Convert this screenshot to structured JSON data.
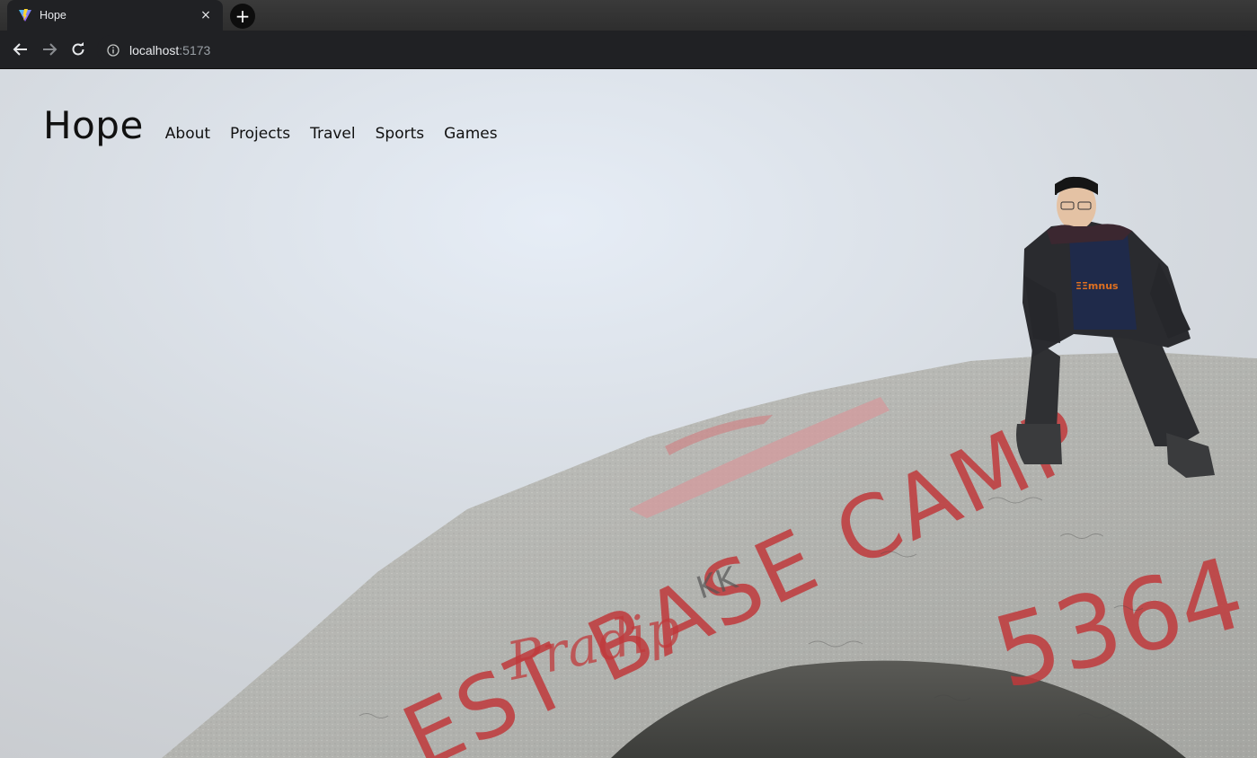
{
  "browser": {
    "tab_title": "Hope",
    "tab_close": "×",
    "new_tab": "+",
    "url_host": "localhost",
    "url_port": ":5173"
  },
  "site": {
    "brand": "Hope",
    "nav": [
      "About",
      "Projects",
      "Travel",
      "Sports",
      "Games"
    ]
  },
  "hero": {
    "rock_text_main": "EST BASE CAMP",
    "rock_text_number": "5364",
    "rock_text_script": "Pradip",
    "rock_text_kk": "KK",
    "paint_color": "#c0393b"
  }
}
